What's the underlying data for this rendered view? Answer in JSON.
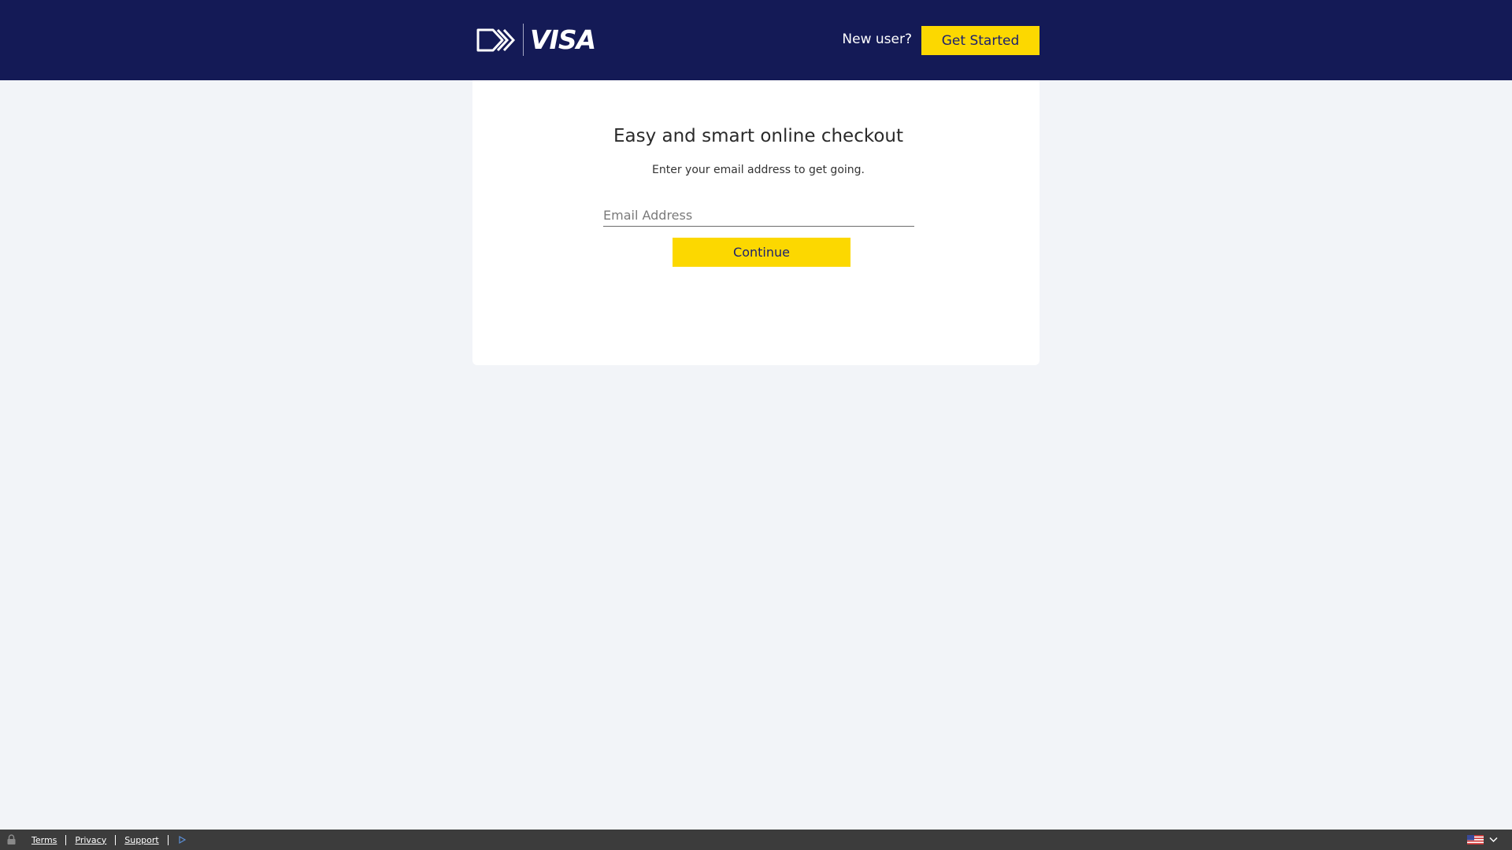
{
  "header": {
    "brand": "VISA",
    "new_user_label": "New user?",
    "get_started_label": "Get Started"
  },
  "main": {
    "title": "Easy and smart online checkout",
    "subtitle": "Enter your email address to get going.",
    "email_placeholder": "Email Address",
    "continue_label": "Continue"
  },
  "footer": {
    "links": [
      "Terms",
      "Privacy",
      "Support"
    ],
    "icons": [
      "lock-icon",
      "play-icon",
      "us-flag-icon",
      "chevron-down-icon"
    ]
  },
  "colors": {
    "header_bg": "#141a56",
    "accent_yellow": "#fcd800",
    "page_bg": "#f2f4f8",
    "footer_bg": "#3c3c3c"
  }
}
